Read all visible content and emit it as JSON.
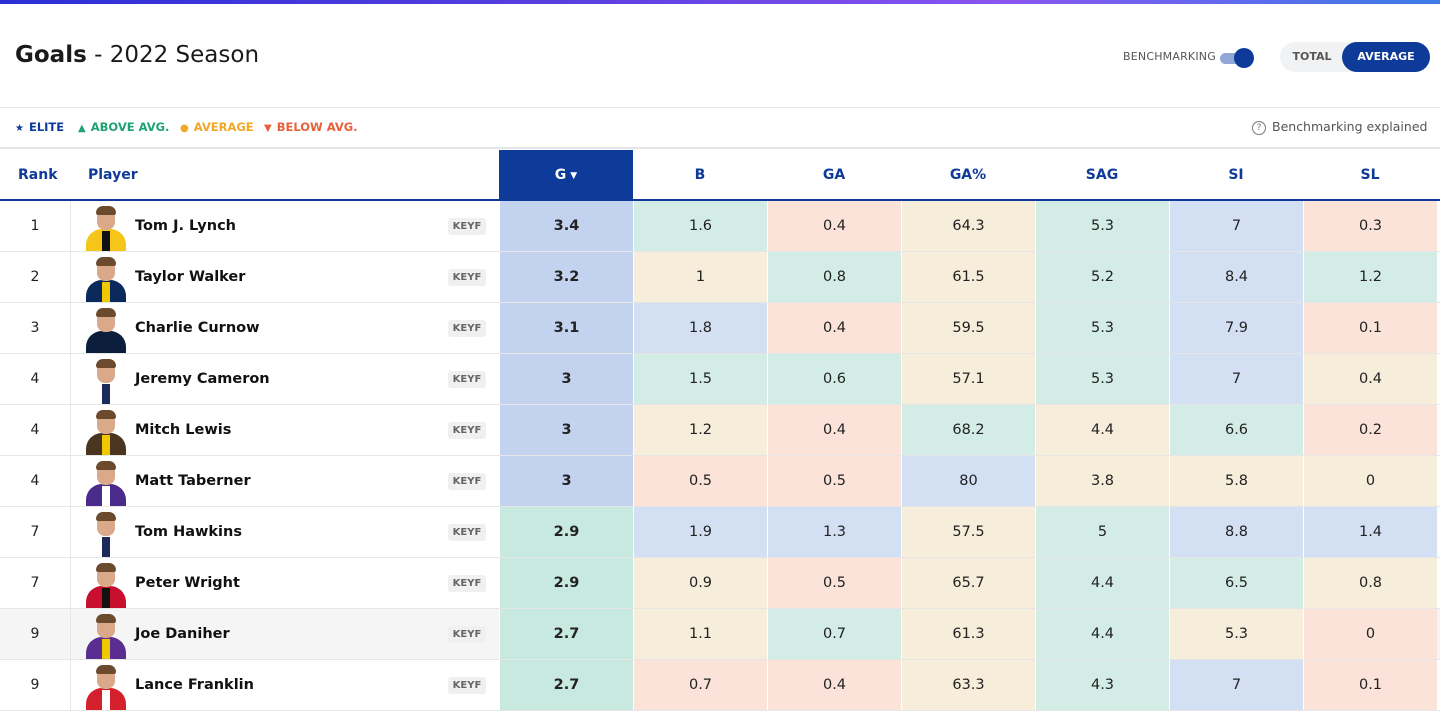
{
  "header": {
    "title_bold": "Goals",
    "title_rest": " - 2022 Season"
  },
  "controls": {
    "benchmarking_label": "BENCHMARKING",
    "total_label": "TOTAL",
    "average_label": "AVERAGE",
    "benchmarking_on": true,
    "selected_mode": "AVERAGE"
  },
  "legend": {
    "elite": "ELITE",
    "above": "ABOVE AVG.",
    "average": "AVERAGE",
    "below": "BELOW AVG.",
    "explained": "Benchmarking explained"
  },
  "colors": {
    "accent": "#0e3a9a",
    "elite": "#d3e0f4",
    "elite_g": "#c3d3ef",
    "above": "#d3ede6",
    "above_g": "#c8e9df",
    "average": "#f7eddb",
    "below": "#fbe3da"
  },
  "table": {
    "columns": {
      "rank": "Rank",
      "player": "Player",
      "stats": [
        "G",
        "B",
        "GA",
        "GA%",
        "SAG",
        "SI",
        "SL"
      ]
    },
    "sorted_column": "G",
    "rows": [
      {
        "rank": "1",
        "name": "Tom J. Lynch",
        "badge": "KEYF",
        "stats": [
          "3.4",
          "1.6",
          "0.4",
          "64.3",
          "5.3",
          "7",
          "0.3"
        ],
        "tiers": [
          "elite",
          "above",
          "below",
          "average",
          "above",
          "elite",
          "below"
        ],
        "jersey": "#f5c518",
        "stripe": "#111"
      },
      {
        "rank": "2",
        "name": "Taylor Walker",
        "badge": "KEYF",
        "stats": [
          "3.2",
          "1",
          "0.8",
          "61.5",
          "5.2",
          "8.4",
          "1.2"
        ],
        "tiers": [
          "elite",
          "average",
          "above",
          "average",
          "above",
          "elite",
          "above"
        ],
        "jersey": "#0b2a5c",
        "stripe": "#f0c800"
      },
      {
        "rank": "3",
        "name": "Charlie Curnow",
        "badge": "KEYF",
        "stats": [
          "3.1",
          "1.8",
          "0.4",
          "59.5",
          "5.3",
          "7.9",
          "0.1"
        ],
        "tiers": [
          "elite",
          "elite",
          "below",
          "average",
          "above",
          "elite",
          "below"
        ],
        "jersey": "#0b1e3c",
        "stripe": "#0b1e3c"
      },
      {
        "rank": "4",
        "name": "Jeremy Cameron",
        "badge": "KEYF",
        "stats": [
          "3",
          "1.5",
          "0.6",
          "57.1",
          "5.3",
          "7",
          "0.4"
        ],
        "tiers": [
          "elite",
          "above",
          "above",
          "average",
          "above",
          "elite",
          "average"
        ],
        "jersey": "#ffffff",
        "stripe": "#1b2a5a"
      },
      {
        "rank": "4",
        "name": "Mitch Lewis",
        "badge": "KEYF",
        "stats": [
          "3",
          "1.2",
          "0.4",
          "68.2",
          "4.4",
          "6.6",
          "0.2"
        ],
        "tiers": [
          "elite",
          "average",
          "below",
          "above",
          "average",
          "above",
          "below"
        ],
        "jersey": "#4a3520",
        "stripe": "#f0c800"
      },
      {
        "rank": "4",
        "name": "Matt Taberner",
        "badge": "KEYF",
        "stats": [
          "3",
          "0.5",
          "0.5",
          "80",
          "3.8",
          "5.8",
          "0"
        ],
        "tiers": [
          "elite",
          "below",
          "below",
          "elite",
          "average",
          "average",
          "average"
        ],
        "jersey": "#4a2a8a",
        "stripe": "#ffffff"
      },
      {
        "rank": "7",
        "name": "Tom Hawkins",
        "badge": "KEYF",
        "stats": [
          "2.9",
          "1.9",
          "1.3",
          "57.5",
          "5",
          "8.8",
          "1.4"
        ],
        "tiers": [
          "above",
          "elite",
          "elite",
          "average",
          "above",
          "elite",
          "elite"
        ],
        "jersey": "#ffffff",
        "stripe": "#1b2a5a"
      },
      {
        "rank": "7",
        "name": "Peter Wright",
        "badge": "KEYF",
        "stats": [
          "2.9",
          "0.9",
          "0.5",
          "65.7",
          "4.4",
          "6.5",
          "0.8"
        ],
        "tiers": [
          "above",
          "average",
          "below",
          "average",
          "above",
          "above",
          "average"
        ],
        "jersey": "#c8102e",
        "stripe": "#111"
      },
      {
        "rank": "9",
        "name": "Joe Daniher",
        "badge": "KEYF",
        "stats": [
          "2.7",
          "1.1",
          "0.7",
          "61.3",
          "4.4",
          "5.3",
          "0"
        ],
        "tiers": [
          "above",
          "average",
          "above",
          "average",
          "above",
          "average",
          "below"
        ],
        "jersey": "#5a2d91",
        "stripe": "#f0c800",
        "highlight": true
      },
      {
        "rank": "9",
        "name": "Lance Franklin",
        "badge": "KEYF",
        "stats": [
          "2.7",
          "0.7",
          "0.4",
          "63.3",
          "4.3",
          "7",
          "0.1"
        ],
        "tiers": [
          "above",
          "below",
          "below",
          "average",
          "above",
          "elite",
          "below"
        ],
        "jersey": "#d4202c",
        "stripe": "#ffffff"
      }
    ]
  }
}
